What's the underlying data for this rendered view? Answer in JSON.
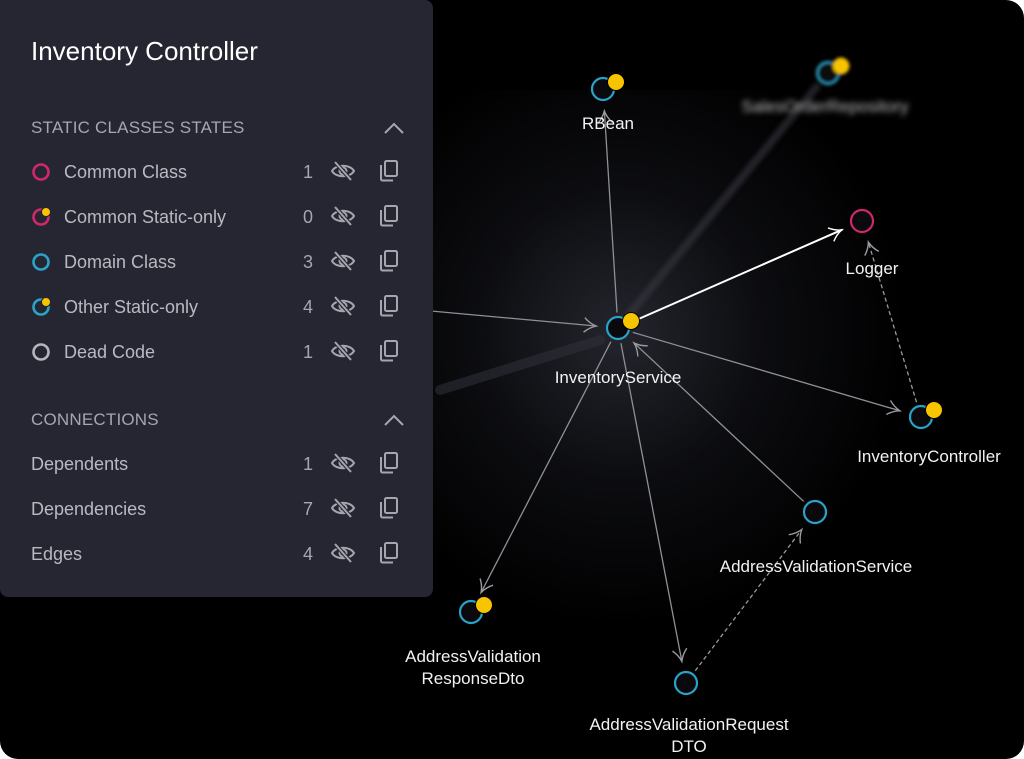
{
  "panel": {
    "title": "Inventory Controller",
    "sections": [
      {
        "title": "STATIC CLASSES STATES",
        "collapse_icon": "chevron-up-icon",
        "items": [
          {
            "label": "Common Class",
            "count": "1",
            "marker": "common-class"
          },
          {
            "label": "Common Static-only",
            "count": "0",
            "marker": "common-static"
          },
          {
            "label": "Domain Class",
            "count": "3",
            "marker": "domain-class"
          },
          {
            "label": "Other Static-only",
            "count": "4",
            "marker": "other-static"
          },
          {
            "label": "Dead Code",
            "count": "1",
            "marker": "dead-code"
          }
        ]
      },
      {
        "title": "CONNECTIONS",
        "collapse_icon": "chevron-up-icon",
        "items": [
          {
            "label": "Dependents",
            "count": "1"
          },
          {
            "label": "Dependencies",
            "count": "7"
          },
          {
            "label": "Edges",
            "count": "4"
          }
        ]
      }
    ],
    "row_icons": [
      "eye-off-icon",
      "copy-icon"
    ]
  },
  "colors": {
    "common": "#d0286a",
    "domain": "#2aa3c8",
    "static_dot": "#f8c400",
    "dead": "#b5b5bb",
    "panel_bg": "#252631",
    "canvas_bg": "#000000"
  },
  "graph": {
    "nodes": [
      {
        "id": "InventoryService",
        "label": [
          "InventoryService"
        ],
        "type": "other-static",
        "focused": true
      },
      {
        "id": "RBean",
        "label": [
          "RBean"
        ],
        "type": "other-static"
      },
      {
        "id": "SalesOrderRepository",
        "label": [
          "SalesOrderRepository"
        ],
        "type": "other-static",
        "blurred": true
      },
      {
        "id": "Logger",
        "label": [
          "Logger"
        ],
        "type": "common-class"
      },
      {
        "id": "InventoryController",
        "label": [
          "InventoryController"
        ],
        "type": "other-static"
      },
      {
        "id": "AddressValidationService",
        "label": [
          "AddressValidationService"
        ],
        "type": "domain-class"
      },
      {
        "id": "AddressValidationResponseDto",
        "label": [
          "AddressValidation",
          "ResponseDto"
        ],
        "type": "other-static"
      },
      {
        "id": "AddressValidationRequestDTO",
        "label": [
          "AddressValidationRequest",
          "DTO"
        ],
        "type": "domain-class"
      }
    ],
    "edges": [
      {
        "from": "InventoryService",
        "to": "RBean",
        "style": "solid"
      },
      {
        "from": "InventoryService",
        "to": "Logger",
        "style": "highlight"
      },
      {
        "from": "InventoryService",
        "to": "InventoryController",
        "style": "solid"
      },
      {
        "from": "InventoryService",
        "to": "AddressValidationResponseDto",
        "style": "solid"
      },
      {
        "from": "InventoryService",
        "to": "AddressValidationRequestDTO",
        "style": "solid"
      },
      {
        "from": "AddressValidationService",
        "to": "InventoryService",
        "style": "solid"
      },
      {
        "from": "InventoryController",
        "to": "Logger",
        "style": "dashed"
      },
      {
        "from": "AddressValidationRequestDTO",
        "to": "AddressValidationService",
        "style": "dashed"
      },
      {
        "from": "InventoryService",
        "to": "SalesOrderRepository",
        "style": "faded"
      },
      {
        "from": "offscreen-left",
        "to": "InventoryService",
        "style": "solid"
      }
    ]
  }
}
